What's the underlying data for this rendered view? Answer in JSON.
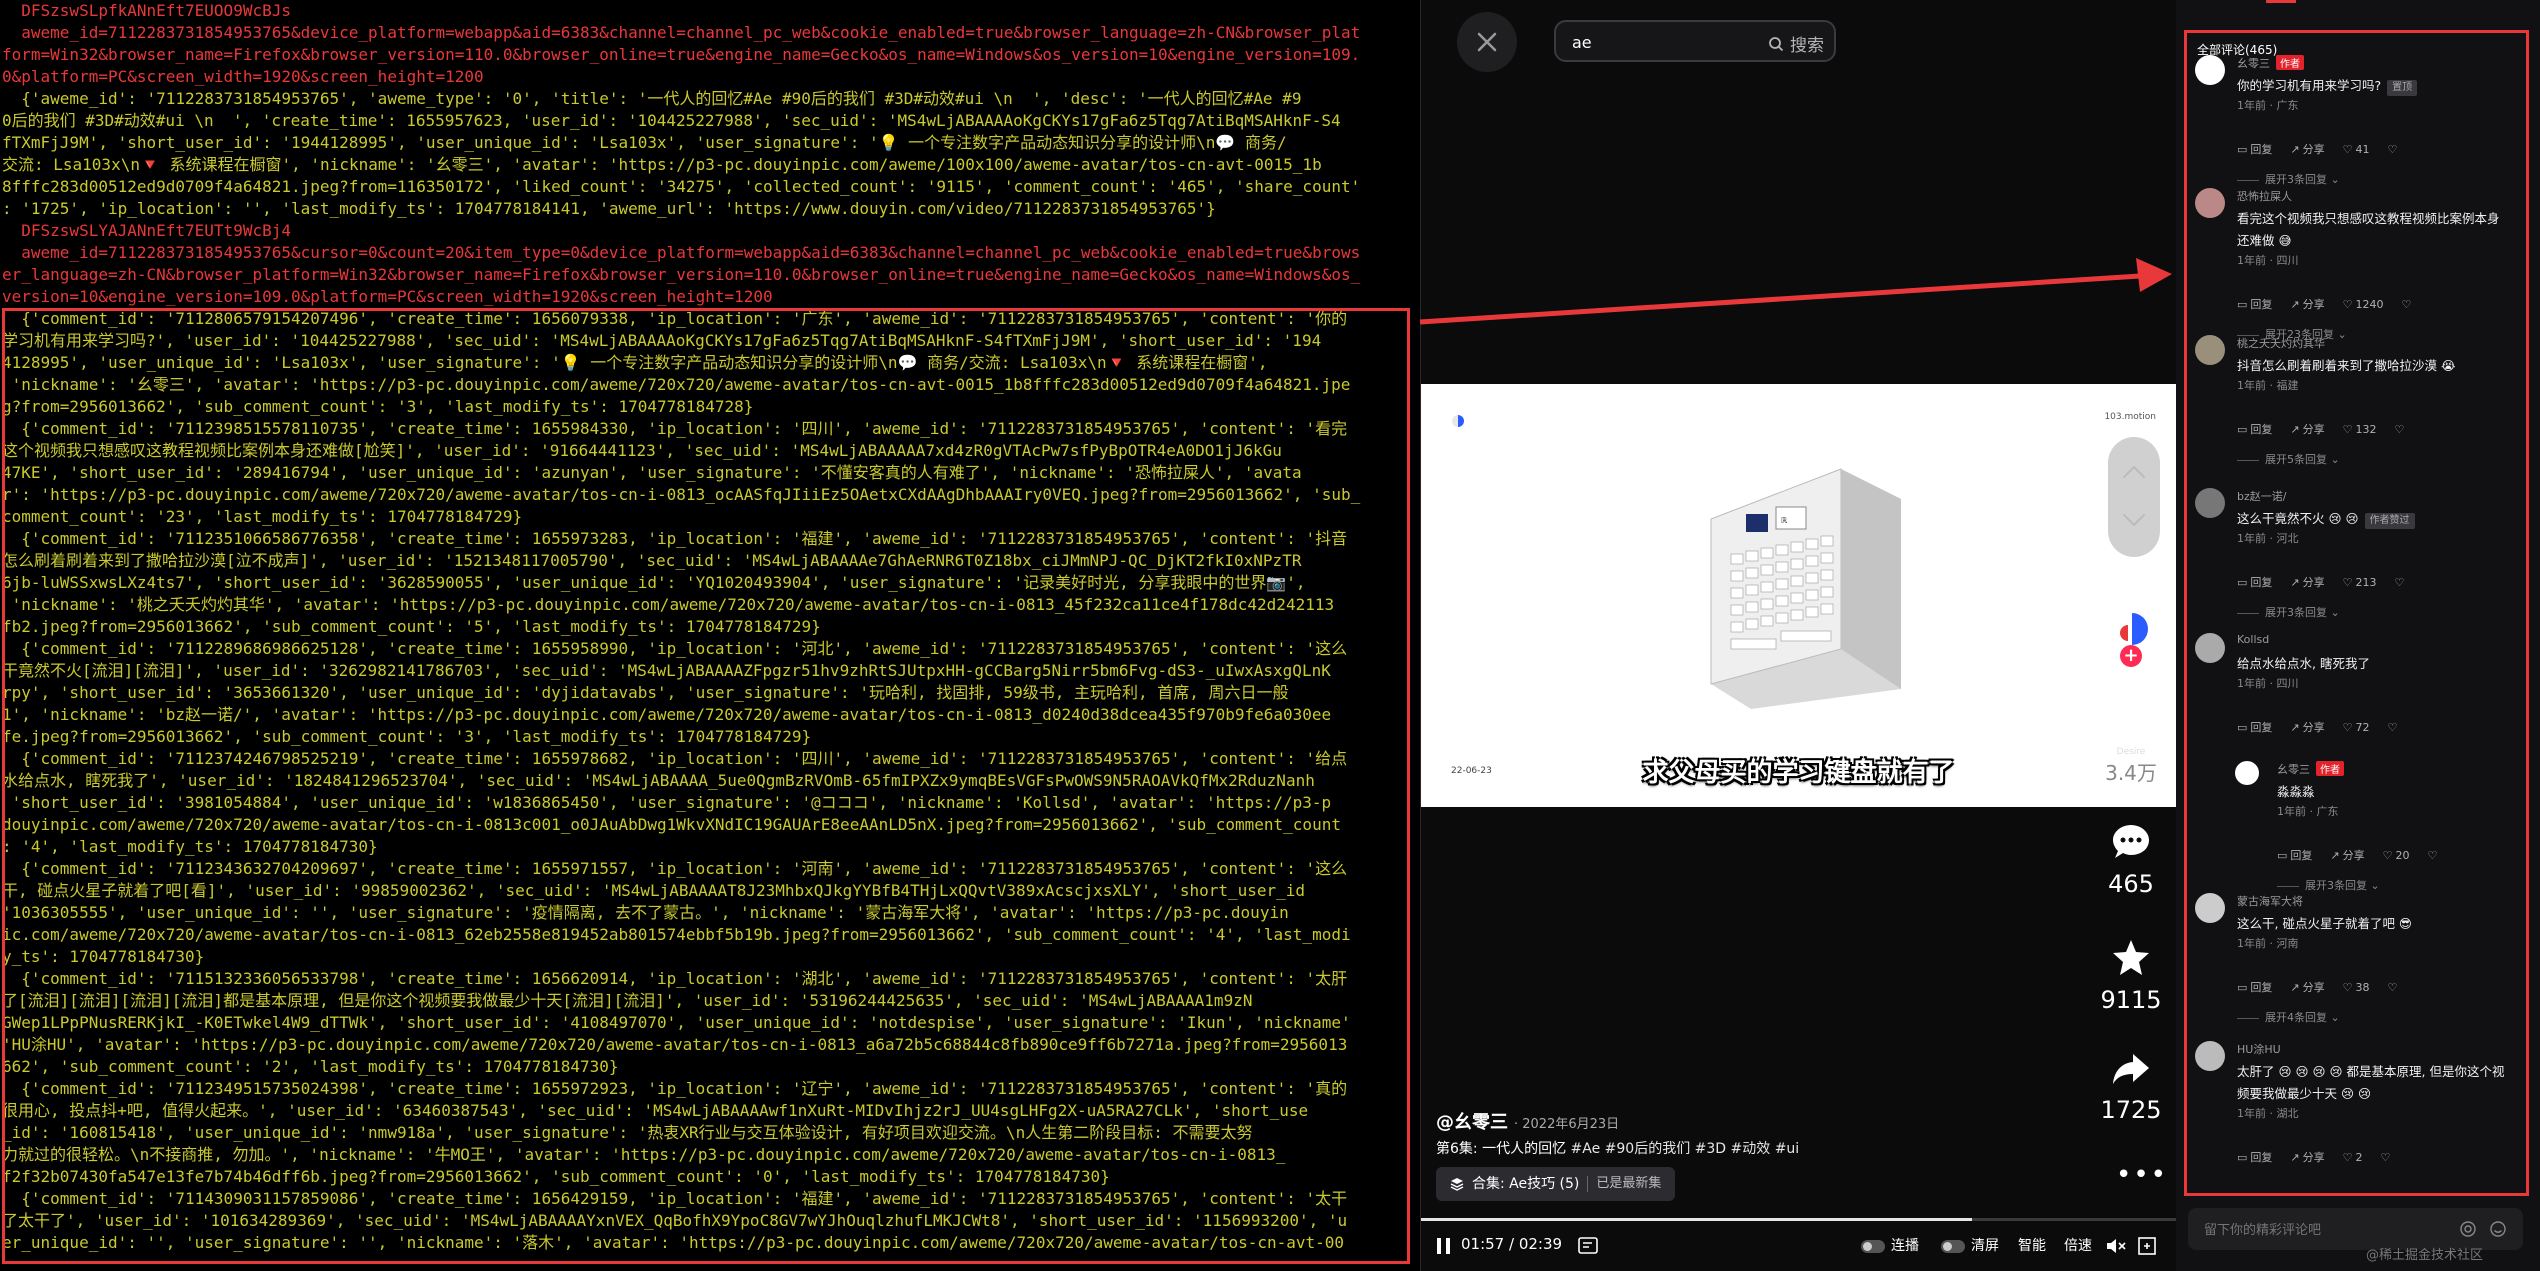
{
  "terminal": {
    "lines": [
      {
        "text": "  DFSzswSLpfkANnEft7EUOO9WcBJs",
        "style": "red"
      },
      {
        "text": "  aweme_id=7112283731854953765&device_platform=webapp&aid=6383&channel=channel_pc_web&cookie_enabled=true&browser_language=zh-CN&browser_plat",
        "style": "red"
      },
      {
        "text": "form=Win32&browser_name=Firefox&browser_version=110.0&browser_online=true&engine_name=Gecko&os_name=Windows&os_version=10&engine_version=109.",
        "style": "red"
      },
      {
        "text": "0&platform=PC&screen_width=1920&screen_height=1200",
        "style": "red"
      },
      {
        "text": "  {'aweme_id': '7112283731854953765', 'aweme_type': '0', 'title': '一代人的回忆#Ae #90后的我们 #3D#动效#ui \\n  ', 'desc': '一代人的回忆#Ae #9",
        "style": ""
      },
      {
        "text": "0后的我们 #3D#动效#ui \\n  ', 'create_time': 1655957623, 'user_id': '104425227988', 'sec_uid': 'MS4wLjABAAAAoKgCKYs17gFa6z5Tqg7AtiBqMSAHknF-S4",
        "style": ""
      },
      {
        "text": "fTXmFjJ9M', 'short_user_id': '1944128995', 'user_unique_id': 'Lsa103x', 'user_signature': '💡 一个专注数字产品动态知识分享的设计师\\n💬 商务/",
        "style": ""
      },
      {
        "text": "交流: Lsa103x\\n🔻 系统课程在橱窗', 'nickname': '幺零三', 'avatar': 'https://p3-pc.douyinpic.com/aweme/100x100/aweme-avatar/tos-cn-avt-0015_1b",
        "style": ""
      },
      {
        "text": "8fffc283d00512ed9d0709f4a64821.jpeg?from=116350172', 'liked_count': '34275', 'collected_count': '9115', 'comment_count': '465', 'share_count'",
        "style": ""
      },
      {
        "text": ": '1725', 'ip_location': '', 'last_modify_ts': 1704778184141, 'aweme_url': 'https://www.douyin.com/video/7112283731854953765'}",
        "style": ""
      },
      {
        "text": "  DFSzswSLYAJANnEft7EUTt9WcBj4",
        "style": "red"
      },
      {
        "text": "  aweme_id=7112283731854953765&cursor=0&count=20&item_type=0&device_platform=webapp&aid=6383&channel=channel_pc_web&cookie_enabled=true&brows",
        "style": "red"
      },
      {
        "text": "er_language=zh-CN&browser_platform=Win32&browser_name=Firefox&browser_version=110.0&browser_online=true&engine_name=Gecko&os_name=Windows&os_",
        "style": "red"
      },
      {
        "text": "version=10&engine_version=109.0&platform=PC&screen_width=1920&screen_height=1200",
        "style": "red"
      },
      {
        "text": "  {'comment_id': '7112806579154207496', 'create_time': 1656079338, 'ip_location': '广东', 'aweme_id': '7112283731854953765', 'content': '你的",
        "style": ""
      },
      {
        "text": "学习机有用来学习吗?', 'user_id': '104425227988', 'sec_uid': 'MS4wLjABAAAAoKgCKYs17gFa6z5Tqg7AtiBqMSAHknF-S4fTXmFjJ9M', 'short_user_id': '194",
        "style": ""
      },
      {
        "text": "4128995', 'user_unique_id': 'Lsa103x', 'user_signature': '💡 一个专注数字产品动态知识分享的设计师\\n💬 商务/交流: Lsa103x\\n🔻 系统课程在橱窗',",
        "style": ""
      },
      {
        "text": " 'nickname': '幺零三', 'avatar': 'https://p3-pc.douyinpic.com/aweme/720x720/aweme-avatar/tos-cn-avt-0015_1b8fffc283d00512ed9d0709f4a64821.jpe",
        "style": ""
      },
      {
        "text": "g?from=2956013662', 'sub_comment_count': '3', 'last_modify_ts': 1704778184728}",
        "style": ""
      },
      {
        "text": "  {'comment_id': '7112398515578110735', 'create_time': 1655984330, 'ip_location': '四川', 'aweme_id': '7112283731854953765', 'content': '看完",
        "style": ""
      },
      {
        "text": "这个视频我只想感叹这教程视频比案例本身还难做[尬笑]', 'user_id': '91664441123', 'sec_uid': 'MS4wLjABAAAAA7xd4zR0gVTAcPw7sfPyBpOTR4eA0DO1jJ6kGu",
        "style": ""
      },
      {
        "text": "47KE', 'short_user_id': '289416794', 'user_unique_id': 'azunyan', 'user_signature': '不懂安客真的人有难了', 'nickname': '恐怖拉屎人', 'avata",
        "style": ""
      },
      {
        "text": "r': 'https://p3-pc.douyinpic.com/aweme/720x720/aweme-avatar/tos-cn-i-0813_ocAASfqJIiiEz5OAetxCXdAAgDhbAAAIry0VEQ.jpeg?from=2956013662', 'sub_",
        "style": ""
      },
      {
        "text": "comment_count': '23', 'last_modify_ts': 1704778184729}",
        "style": ""
      },
      {
        "text": "  {'comment_id': '7112351066586776358', 'create_time': 1655973283, 'ip_location': '福建', 'aweme_id': '7112283731854953765', 'content': '抖音",
        "style": ""
      },
      {
        "text": "怎么刷着刷着来到了撒哈拉沙漠[泣不成声]', 'user_id': '1521348117005790', 'sec_uid': 'MS4wLjABAAAAe7GhAeRNR6T0Z18bx_ciJMmNPJ-QC_DjKT2fkI0xNPzTR",
        "style": ""
      },
      {
        "text": "6jb-luWSSxwsLXz4ts7', 'short_user_id': '3628590055', 'user_unique_id': 'YQ1020493904', 'user_signature': '记录美好时光, 分享我眼中的世界📷',",
        "style": ""
      },
      {
        "text": " 'nickname': '桃之夭夭灼灼其华', 'avatar': 'https://p3-pc.douyinpic.com/aweme/720x720/aweme-avatar/tos-cn-i-0813_45f232ca11ce4f178dc42d242113",
        "style": ""
      },
      {
        "text": "fb2.jpeg?from=2956013662', 'sub_comment_count': '5', 'last_modify_ts': 1704778184729}",
        "style": ""
      },
      {
        "text": "  {'comment_id': '7112289686986625128', 'create_time': 1655958990, 'ip_location': '河北', 'aweme_id': '7112283731854953765', 'content': '这么",
        "style": ""
      },
      {
        "text": "干竟然不火[流泪][流泪]', 'user_id': '3262982141786703', 'sec_uid': 'MS4wLjABAAAAZFpgzr51hv9zhRtSJUtpxHH-gCCBarg5Nirr5bm6Fvg-dS3-_uIwxAsxgQLnK",
        "style": ""
      },
      {
        "text": "rpy', 'short_user_id': '3653661320', 'user_unique_id': 'dyjidatavabs', 'user_signature': '玩哈利, 找固排, 59级书, 主玩哈利, 首席, 周六日一般",
        "style": ""
      },
      {
        "text": "1', 'nickname': 'bz赵一诺/', 'avatar': 'https://p3-pc.douyinpic.com/aweme/720x720/aweme-avatar/tos-cn-i-0813_d0240d38dcea435f970b9fe6a030ee",
        "style": ""
      },
      {
        "text": "fe.jpeg?from=2956013662', 'sub_comment_count': '3', 'last_modify_ts': 1704778184729}",
        "style": ""
      },
      {
        "text": "  {'comment_id': '7112374246798525219', 'create_time': 1655978682, 'ip_location': '四川', 'aweme_id': '7112283731854953765', 'content': '给点",
        "style": ""
      },
      {
        "text": "水给点水, 瞎死我了', 'user_id': '1824841296523704', 'sec_uid': 'MS4wLjABAAAA_5ue0QgmBzRVOmB-65fmIPXZx9ymqBEsVGFsPwOWS9N5RAOAVkQfMx2RduzNanh",
        "style": ""
      },
      {
        "text": " 'short_user_id': '3981054884', 'user_unique_id': 'w1836865450', 'user_signature': '@コココ', 'nickname': 'Kollsd', 'avatar': 'https://p3-p",
        "style": ""
      },
      {
        "text": "douyinpic.com/aweme/720x720/aweme-avatar/tos-cn-i-0813c001_o0JAuAbDwg1WkvXNdIC19GAUArE8eeAAnLD5nX.jpeg?from=2956013662', 'sub_comment_count",
        "style": ""
      },
      {
        "text": ": '4', 'last_modify_ts': 1704778184730}",
        "style": ""
      },
      {
        "text": "  {'comment_id': '7112343632704209697', 'create_time': 1655971557, 'ip_location': '河南', 'aweme_id': '7112283731854953765', 'content': '这么",
        "style": ""
      },
      {
        "text": "干, 碰点火星子就着了吧[看]', 'user_id': '99859002362', 'sec_uid': 'MS4wLjABAAAAT8J23MhbxQJkgYYBfB4THjLxQQvtV389xAcscjxsXLY', 'short_user_id",
        "style": ""
      },
      {
        "text": "'1036305555', 'user_unique_id': '', 'user_signature': '疫情隔离, 去不了蒙古。', 'nickname': '蒙古海军大将', 'avatar': 'https://p3-pc.douyin",
        "style": ""
      },
      {
        "text": "ic.com/aweme/720x720/aweme-avatar/tos-cn-i-0813_62eb2558e819452ab801574ebbf5b19b.jpeg?from=2956013662', 'sub_comment_count': '4', 'last_modi",
        "style": ""
      },
      {
        "text": "y_ts': 1704778184730}",
        "style": ""
      },
      {
        "text": "  {'comment_id': '7115132336056533798', 'create_time': 1656620914, 'ip_location': '湖北', 'aweme_id': '7112283731854953765', 'content': '太肝",
        "style": ""
      },
      {
        "text": "了[流泪][流泪][流泪][流泪]都是基本原理, 但是你这个视频要我做最少十天[流泪][流泪]', 'user_id': '53196244425635', 'sec_uid': 'MS4wLjABAAAA1m9zN",
        "style": ""
      },
      {
        "text": "GWep1LPpPNusRERKjkI_-K0ETwkel4W9_dTTWk', 'short_user_id': '4108497070', 'user_unique_id': 'notdespise', 'user_signature': 'Ikun', 'nickname'",
        "style": ""
      },
      {
        "text": "'HU涂HU', 'avatar': 'https://p3-pc.douyinpic.com/aweme/720x720/aweme-avatar/tos-cn-i-0813_a6a72b5c68844c8fb890ce9ff6b7271a.jpeg?from=2956013",
        "style": ""
      },
      {
        "text": "662', 'sub_comment_count': '2', 'last_modify_ts': 1704778184730}",
        "style": ""
      },
      {
        "text": "  {'comment_id': '7112349515735024398', 'create_time': 1655972923, 'ip_location': '辽宁', 'aweme_id': '7112283731854953765', 'content': '真的",
        "style": ""
      },
      {
        "text": "很用心, 投点抖+吧, 值得火起来。', 'user_id': '63460387543', 'sec_uid': 'MS4wLjABAAAAwf1nXuRt-MIDvIhjz2rJ_UU4sgLHFg2X-uA5RA27CLk', 'short_use",
        "style": ""
      },
      {
        "text": "_id': '160815418', 'user_unique_id': 'nmw918a', 'user_signature': '热衷XR行业与交互体验设计, 有好项目欢迎交流。\\n人生第二阶段目标: 不需要太努",
        "style": ""
      },
      {
        "text": "力就过的很轻松。\\n不接商推, 勿加。', 'nickname': '牛MO王', 'avatar': 'https://p3-pc.douyinpic.com/aweme/720x720/aweme-avatar/tos-cn-i-0813_",
        "style": ""
      },
      {
        "text": "f2f32b07430fa547e13fe7b74b46dff6b.jpeg?from=2956013662', 'sub_comment_count': '0', 'last_modify_ts': 1704778184730}",
        "style": ""
      },
      {
        "text": "  {'comment_id': '7114309031157859086', 'create_time': 1656429159, 'ip_location': '福建', 'aweme_id': '7112283731854953765', 'content': '太干",
        "style": ""
      },
      {
        "text": "了太干了', 'user_id': '101634289369', 'sec_uid': 'MS4wLjABAAAAYxnVEX_QqBofhX9YpoC8GV7wYJhOuqlzhufLMKJCWt8', 'short_user_id': '1156993200', 'u",
        "style": ""
      },
      {
        "text": "er_unique_id': '', 'user_signature': '', 'nickname': '落木', 'avatar': 'https://p3-pc.douyinpic.com/aweme/720x720/aweme-avatar/tos-cn-avt-00",
        "style": ""
      }
    ]
  },
  "player": {
    "search": {
      "value": "ae",
      "button_label": "搜索"
    },
    "video": {
      "subtitle": "求父母买的学习键盘就有了",
      "brand": "103.motion",
      "date": "22-06-23"
    },
    "likes": {
      "label": "Desire",
      "count": "3.4万"
    },
    "comments_count": "465",
    "favorites_count": "9115",
    "shares_count": "1725",
    "author": "@幺零三",
    "post_date": "· 2022年6月23日",
    "description": "第6集: 一代人的回忆",
    "tags": "#Ae #90后的我们 #3D #动效 #ui",
    "collection_label": "合集: Ae技巧 (5)",
    "collection_status": "已是最新集",
    "progress_fraction": 0.73,
    "time_current": "01:57",
    "time_total": "02:39",
    "controls": {
      "continuous": "连播",
      "clear": "清屏",
      "smart": "智能",
      "speed": "倍速"
    }
  },
  "comments": {
    "title": "全部评论(465)",
    "reply_placeholder": "留下你的精彩评论吧",
    "watermark": "@稀土掘金技术社区",
    "actions": {
      "reply": "回复",
      "share": "分享"
    },
    "items": [
      {
        "user": "幺零三",
        "author_tag": "作者",
        "text": "你的学习机有用来学习吗?",
        "badge": "置顶",
        "meta": "1年前 · 广东",
        "likes": "41",
        "expand": "展开3条回复"
      },
      {
        "user": "恐怖拉屎人",
        "author_tag": "",
        "text": "看完这个视频我只想感叹这教程视频比案例本身还难做 😅",
        "badge": "",
        "meta": "1年前 · 四川",
        "likes": "1240",
        "expand": "展开23条回复"
      },
      {
        "user": "桃之夭夭灼灼其华",
        "author_tag": "",
        "text": "抖音怎么刷着刷着来到了撒哈拉沙漠 😭",
        "badge": "",
        "meta": "1年前 · 福建",
        "likes": "132",
        "expand": "展开5条回复"
      },
      {
        "user": "bz赵一诺/",
        "author_tag": "",
        "text": "这么干竟然不火 😢 😢",
        "badge": "作者赞过",
        "meta": "1年前 · 河北",
        "likes": "213",
        "expand": "展开3条回复"
      },
      {
        "user": "Kollsd",
        "author_tag": "",
        "text": "给点水给点水, 瞎死我了",
        "badge": "",
        "meta": "1年前 · 四川",
        "likes": "72",
        "expand": ""
      },
      {
        "user": "幺零三",
        "author_tag": "作者",
        "text": "淼淼淼",
        "badge": "",
        "meta": "1年前 · 广东",
        "likes": "20",
        "expand": "展开3条回复"
      },
      {
        "user": "蒙古海军大将",
        "author_tag": "",
        "text": "这么干, 碰点火星子就着了吧 😎",
        "badge": "",
        "meta": "1年前 · 河南",
        "likes": "38",
        "expand": "展开4条回复"
      },
      {
        "user": "HU涂HU",
        "author_tag": "",
        "text": "太肝了 😢 😢 😢 😢 都是基本原理, 但是你这个视频要我做最少十天 😢 😢",
        "badge": "",
        "meta": "1年前 · 湖北",
        "likes": "2",
        "expand": ""
      }
    ]
  },
  "colors": {
    "highlight": "#e8383a",
    "terminal_text": "#c9c930",
    "author_tag": "#e3232c"
  }
}
